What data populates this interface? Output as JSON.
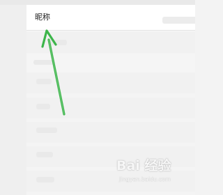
{
  "profile": {
    "nickname_label": "昵称"
  },
  "annotation": {
    "arrow_color": "#3cb54a",
    "icon": "green-arrow-icon"
  },
  "watermark": {
    "main_text": "Bai 经验",
    "sub_text": "jingyan.baidu.com"
  }
}
